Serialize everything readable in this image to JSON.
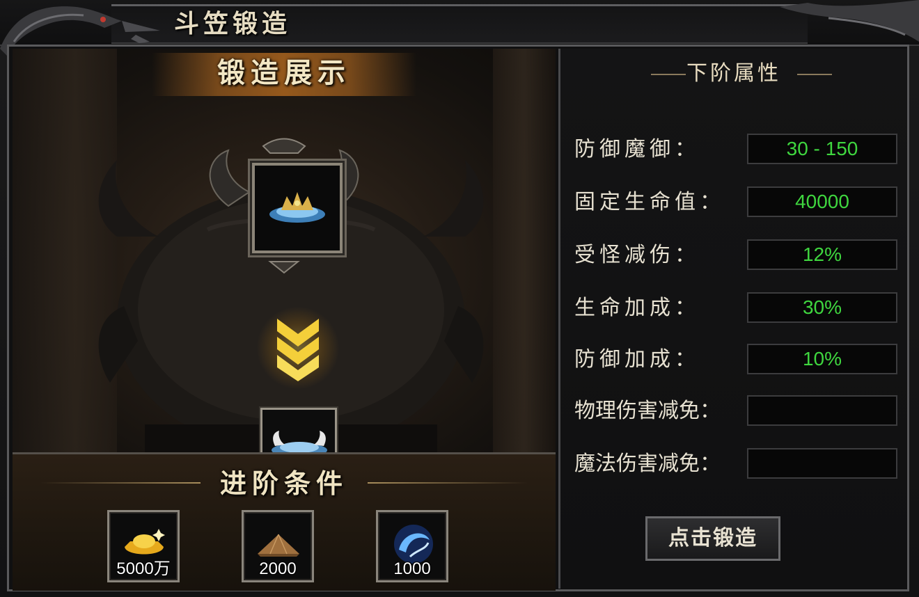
{
  "window": {
    "title": "斗笠锻造"
  },
  "display": {
    "title": "锻造展示"
  },
  "conditions": {
    "title": "进阶条件",
    "items": [
      {
        "name": "gold-ingot",
        "count": "5000万"
      },
      {
        "name": "bamboo-hat",
        "count": "2000"
      },
      {
        "name": "blue-crystal",
        "count": "1000"
      }
    ]
  },
  "attributes": {
    "title": "下阶属性",
    "rows": [
      {
        "label": "防御魔御：",
        "value": "30 - 150"
      },
      {
        "label": "固定生命值：",
        "value": "40000"
      },
      {
        "label": "受怪减伤：",
        "value": "12%"
      },
      {
        "label": "生命加成：",
        "value": "30%"
      },
      {
        "label": "防御加成：",
        "value": "10%"
      },
      {
        "label": "物理伤害减免：",
        "value": ""
      },
      {
        "label": "魔法伤害减免：",
        "value": ""
      }
    ]
  },
  "actions": {
    "forge_label": "点击锻造"
  },
  "colors": {
    "value_green": "#3fd63f",
    "accent_gold": "#c9a24a"
  }
}
